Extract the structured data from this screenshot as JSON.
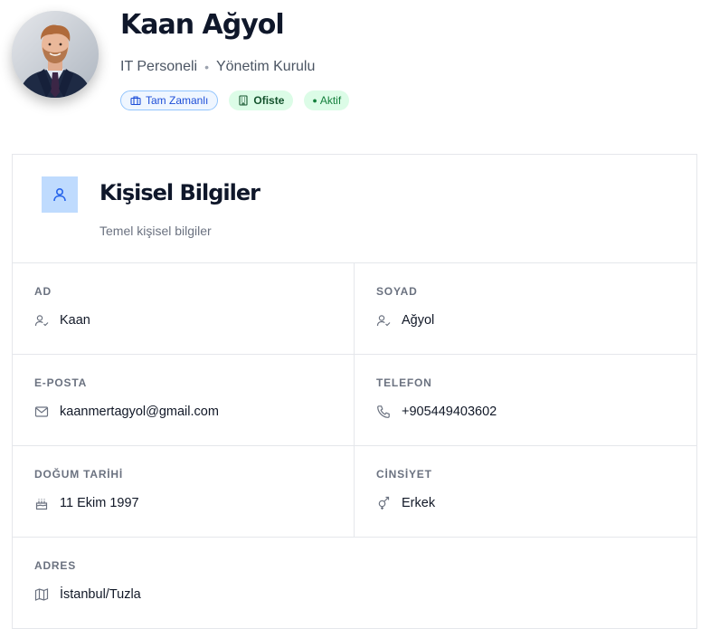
{
  "profile": {
    "name": "Kaan Ağyol",
    "role": "IT Personeli",
    "separator": "•",
    "department": "Yönetim Kurulu",
    "avatar_alt": "profile-photo"
  },
  "badges": [
    {
      "label": "Tam Zamanlı",
      "icon": "briefcase-icon",
      "color": "#1d4ed8"
    },
    {
      "label": "Ofiste",
      "icon": "building-icon",
      "color": "#14532d"
    },
    {
      "label": "Aktif",
      "icon": "status-dot-icon",
      "prefix": "●",
      "color": "#15803d"
    }
  ],
  "section": {
    "title": "Kişisel Bilgiler",
    "subtitle": "Temel kişisel bilgiler",
    "icon": "user-icon",
    "icon_bg": "#bfdbfe",
    "icon_color": "#2563eb"
  },
  "fields": {
    "first_name": {
      "label": "AD",
      "value": "Kaan",
      "icon": "user-check-icon"
    },
    "last_name": {
      "label": "SOYAD",
      "value": "Ağyol",
      "icon": "user-check-icon"
    },
    "email": {
      "label": "E-POSTA",
      "value": "kaanmertagyol@gmail.com",
      "icon": "mail-icon"
    },
    "phone": {
      "label": "TELEFON",
      "value": "+905449403602",
      "icon": "phone-icon"
    },
    "birth_date": {
      "label": "DOĞUM TARİHİ",
      "value": "11 Ekim 1997",
      "icon": "cake-icon"
    },
    "gender": {
      "label": "CİNSİYET",
      "value": "Erkek",
      "icon": "gender-icon"
    },
    "address": {
      "label": "ADRES",
      "value": "İstanbul/Tuzla",
      "icon": "map-icon"
    }
  }
}
